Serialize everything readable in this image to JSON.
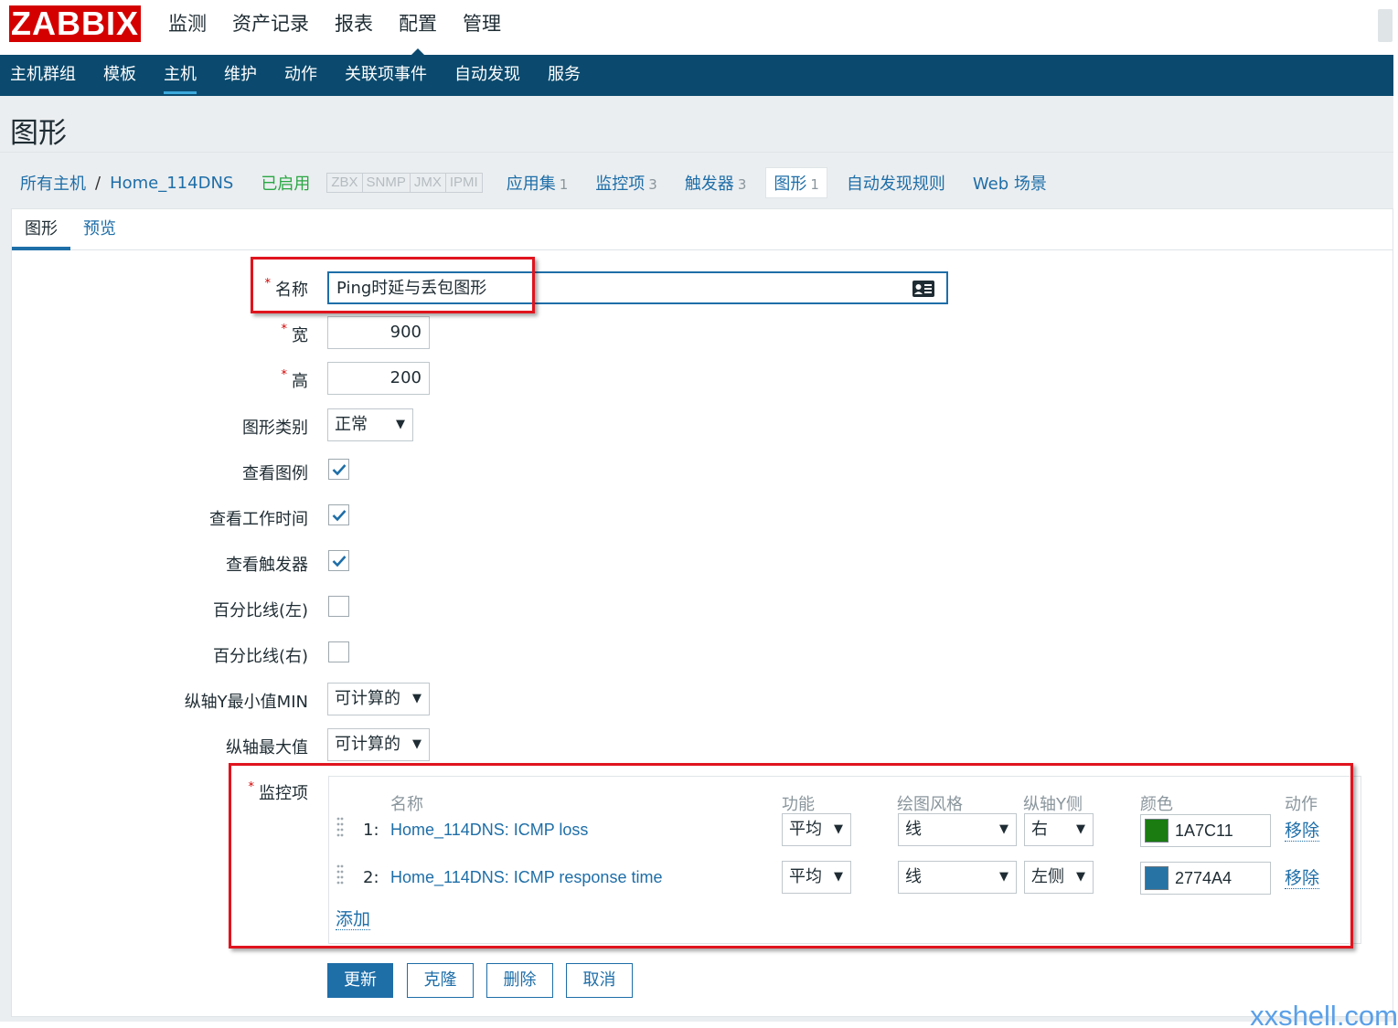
{
  "app": {
    "logo": "ZABBIX",
    "top_menu": [
      "监测",
      "资产记录",
      "报表",
      "配置",
      "管理"
    ],
    "sub_menu": [
      "主机群组",
      "模板",
      "主机",
      "维护",
      "动作",
      "关联项事件",
      "自动发现",
      "服务"
    ]
  },
  "page": {
    "title": "图形"
  },
  "breadcrumb": {
    "all_hosts": "所有主机",
    "separator": "/",
    "host": "Home_114DNS",
    "status": "已启用",
    "availability": [
      "ZBX",
      "SNMP",
      "JMX",
      "IPMI"
    ],
    "links": [
      {
        "label": "应用集",
        "count": "1"
      },
      {
        "label": "监控项",
        "count": "3"
      },
      {
        "label": "触发器",
        "count": "3"
      },
      {
        "label": "图形",
        "count": "1"
      },
      {
        "label": "自动发现规则",
        "count": ""
      },
      {
        "label": "Web 场景",
        "count": ""
      }
    ]
  },
  "tabs": [
    "图形",
    "预览"
  ],
  "form": {
    "required_mark": "*",
    "name_label": "名称",
    "name_value": "Ping时延与丢包图形",
    "width_label": "宽",
    "width_value": "900",
    "height_label": "高",
    "height_value": "200",
    "graph_type_label": "图形类别",
    "graph_type_value": "正常",
    "show_legend_label": "查看图例",
    "show_legend": true,
    "show_work_period_label": "查看工作时间",
    "show_work_period": true,
    "show_triggers_label": "查看触发器",
    "show_triggers": true,
    "percentile_left_label": "百分比线(左)",
    "percentile_left": false,
    "percentile_right_label": "百分比线(右)",
    "percentile_right": false,
    "ymin_label": "纵轴Y最小值MIN",
    "ymin_value": "可计算的",
    "ymax_label": "纵轴最大值",
    "ymax_value": "可计算的",
    "items_label": "监控项"
  },
  "items_table": {
    "headers": {
      "name": "名称",
      "function": "功能",
      "draw_style": "绘图风格",
      "y_axis_side": "纵轴Y侧",
      "color": "颜色",
      "action": "动作"
    },
    "rows": [
      {
        "num": "1:",
        "name": "Home_114DNS: ICMP loss",
        "function": "平均",
        "draw_style": "线",
        "y_axis_side": "右",
        "color_hex": "1A7C11",
        "color": "#1A7C11",
        "action": "移除"
      },
      {
        "num": "2:",
        "name": "Home_114DNS: ICMP response time",
        "function": "平均",
        "draw_style": "线",
        "y_axis_side": "左侧",
        "color_hex": "2774A4",
        "color": "#2774A4",
        "action": "移除"
      }
    ],
    "add_label": "添加"
  },
  "buttons": {
    "update": "更新",
    "clone": "克隆",
    "delete": "删除",
    "cancel": "取消"
  },
  "watermark": "xxshell.com",
  "colors": {
    "brand": "#d40000",
    "nav": "#0b4a6e",
    "link": "#1e6ea8",
    "enabled": "#2aa744",
    "highlight": "#e0141e"
  },
  "icons": [
    "dropdown-arrow-icon",
    "checkmark-icon",
    "id-card-icon",
    "drag-handle-icon"
  ]
}
